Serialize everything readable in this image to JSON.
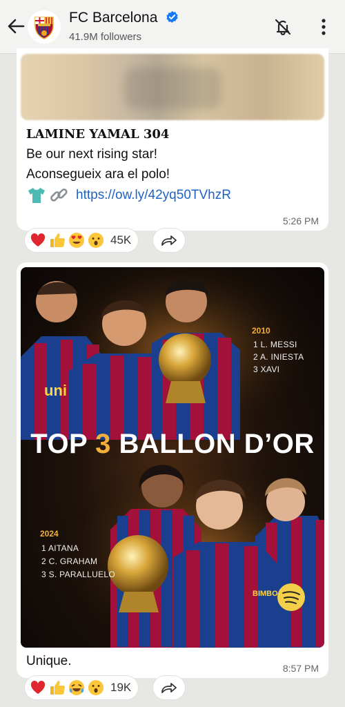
{
  "header": {
    "channel_name": "FC Barcelona",
    "followers": "41.9M followers",
    "icons": [
      "back-arrow-icon",
      "verified-icon",
      "mute-notifications-icon",
      "more-options-icon"
    ]
  },
  "message1": {
    "title": "LAMINE YAMAL 304",
    "line1": "Be our next rising star!",
    "line2": "Aconsegueix ara el polo!",
    "link": "https://ow.ly/42yq50TVhzR",
    "time": "5:26 PM",
    "reactions": [
      "❤️",
      "👍",
      "😍",
      "😮"
    ],
    "reaction_count": "45K"
  },
  "message2": {
    "poster": {
      "title_part1": "TOP ",
      "title_number": "3",
      "title_part2": " BALLON D’OR",
      "men": {
        "year": "2010",
        "ranks": [
          "1  L. MESSI",
          "2  A. INIESTA",
          "3  XAVI"
        ]
      },
      "women": {
        "year": "2024",
        "ranks": [
          "1  AITANA",
          "2  C. GRAHAM",
          "3  S. PARALLUELO"
        ]
      },
      "shirt_text": "uni",
      "sponsor_text": "BIMBO"
    },
    "caption": "Unique.",
    "time": "8:57 PM",
    "reactions": [
      "❤️",
      "👍",
      "😂",
      "😮"
    ],
    "reaction_count": "19K"
  },
  "colors": {
    "background": "#e7e7e3",
    "link": "#1d63c6",
    "poster_accent": "#f2b03a",
    "barca_blue": "#1b3f8f",
    "barca_red": "#a3113a"
  }
}
